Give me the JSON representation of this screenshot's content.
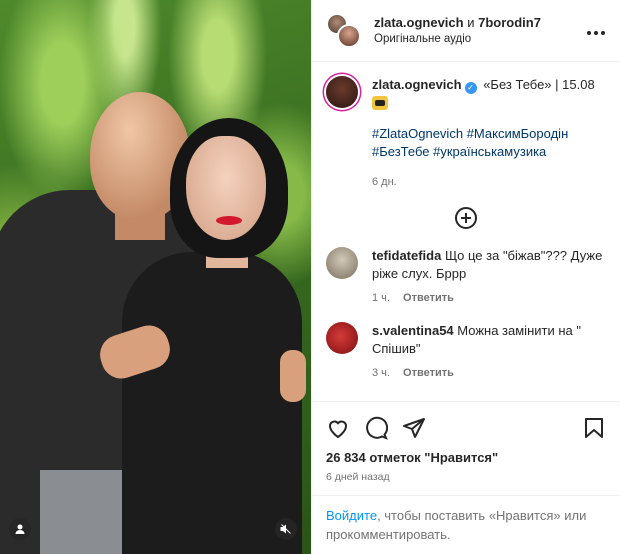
{
  "header": {
    "user1": "zlata.ognevich",
    "conjunction": "и",
    "user2": "7borodin7",
    "audio": "Оригінальне аудіо"
  },
  "caption": {
    "username": "zlata.ognevich",
    "text": "«Без Тебе» | 15.08",
    "hashtags": [
      "#ZlataOgnevich",
      "#МаксимБородін",
      "#БезТебе",
      "#українськамузика"
    ],
    "time": "6 дн."
  },
  "comments": [
    {
      "username": "tefidatefida",
      "text": "Що це за \"біжав\"??? Дуже ріже слух. Бррр",
      "time": "1 ч.",
      "reply": "Ответить"
    },
    {
      "username": "s.valentina54",
      "text": "Можна замінити на \" Спішив\"",
      "time": "3 ч.",
      "reply": "Ответить"
    }
  ],
  "likes": "26 834 отметок \"Нравится\"",
  "posted": "6 дней назад",
  "login": {
    "link": "Войдите",
    "rest": ", чтобы поставить «Нравится» или прокомментировать."
  },
  "icons": {
    "more": "more-horizontal-icon",
    "add": "plus-circle-icon",
    "like": "heart-icon",
    "comment": "comment-icon",
    "share": "paper-plane-icon",
    "save": "bookmark-icon",
    "mute": "muted-speaker-icon",
    "profile": "user-icon"
  },
  "colors": {
    "link": "#0095f6",
    "hashtag": "#00376b",
    "muted": "#737373",
    "verified": "#3897f0"
  }
}
